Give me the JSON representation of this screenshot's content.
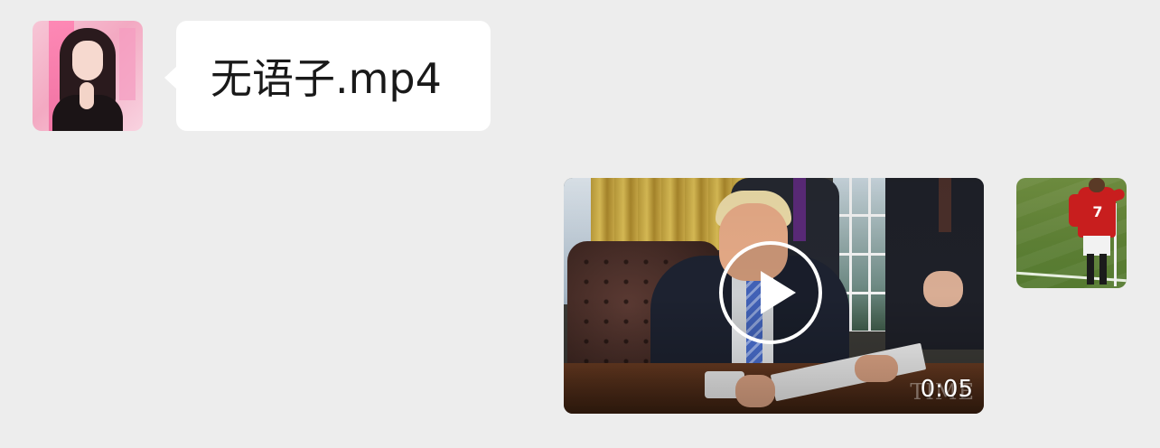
{
  "messages": [
    {
      "direction": "incoming",
      "type": "text",
      "text": "无语子.mp4",
      "avatar_icon": "avatar-girl-icon"
    },
    {
      "direction": "outgoing",
      "type": "video",
      "duration": "0:05",
      "watermark": "TIME",
      "play_icon": "play-icon",
      "avatar_icon": "avatar-footballer-icon",
      "avatar_jersey_number": "7"
    }
  ],
  "colors": {
    "background": "#ededed",
    "incoming_bubble": "#ffffff",
    "text": "#191919",
    "overlay_text": "#ffffff"
  }
}
